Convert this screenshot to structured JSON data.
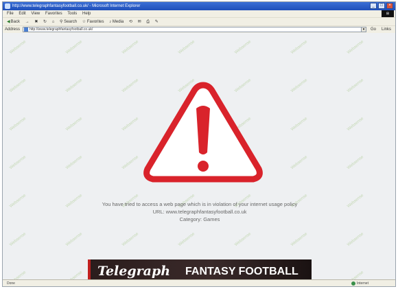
{
  "window": {
    "title": "http://www.telegraphfantasyfootball.co.uk/ - Microsoft Internet Explorer",
    "buttons": [
      "_",
      "□",
      "×"
    ]
  },
  "menu": {
    "items": [
      "File",
      "Edit",
      "View",
      "Favorites",
      "Tools",
      "Help"
    ]
  },
  "toolbar": {
    "back": "Back",
    "forward": "→",
    "search": "Search",
    "favorites": "Favorites",
    "media": "Media"
  },
  "address": {
    "label": "Address",
    "url": "http://www.telegraphfantasyfootball.co.uk/",
    "go": "Go",
    "links": "Links"
  },
  "watermark_text": "Websense",
  "warning": {
    "icon": "warning-triangle-icon",
    "message": "You have tried to access a web page which is in violation of your internet usage policy",
    "url_line": "URL: www.telegraphfantasyfootball.co.uk",
    "category_line": "Category: Games"
  },
  "banner": {
    "brand": "Telegraph",
    "product": "FANTASY FOOTBALL"
  },
  "status": {
    "text": "Done",
    "zone": "Internet"
  },
  "colors": {
    "warning_red": "#d9232b",
    "title_blue": "#2457c5"
  }
}
